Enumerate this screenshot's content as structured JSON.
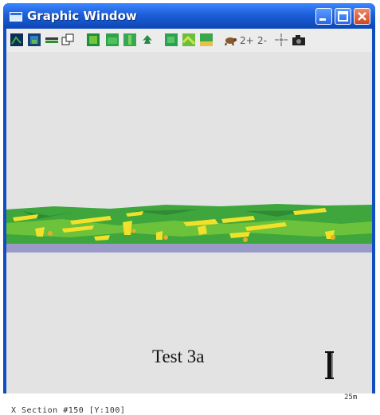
{
  "window": {
    "title": "Graphic Window"
  },
  "toolbar": {
    "tools": [
      {
        "name": "view-dark-1-icon"
      },
      {
        "name": "view-dark-2-icon"
      },
      {
        "name": "layer-bar-icon"
      },
      {
        "name": "copy-icon"
      },
      {
        "name": "terrain-1-icon"
      },
      {
        "name": "terrain-2-icon"
      },
      {
        "name": "terrain-3-icon"
      },
      {
        "name": "tree-icon"
      },
      {
        "name": "map-1-icon"
      },
      {
        "name": "map-2-icon"
      },
      {
        "name": "map-3-icon"
      },
      {
        "name": "turtle-icon"
      },
      {
        "name": "zoom-in-icon"
      },
      {
        "name": "zoom-out-icon"
      },
      {
        "name": "fit-view-icon"
      },
      {
        "name": "camera-icon"
      }
    ]
  },
  "canvas": {
    "caption": "Test 3a",
    "scale_label": "25m",
    "status": "X Section #150 [Y:100]"
  }
}
